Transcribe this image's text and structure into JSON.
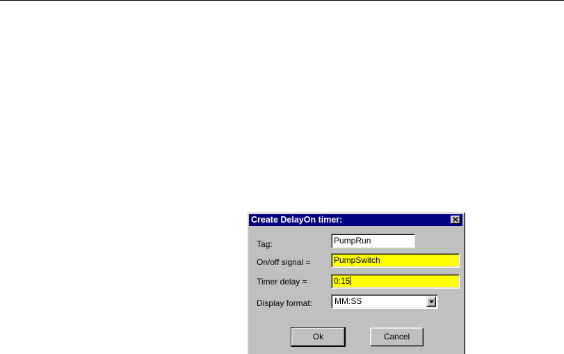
{
  "dialog": {
    "title": "Create DelayOn timer:",
    "fields": {
      "tag": {
        "label": "Tag:",
        "value": "PumpRun"
      },
      "signal": {
        "label": "On/off signal =",
        "value": "PumpSwitch"
      },
      "delay": {
        "label": "Timer delay =",
        "value": "0:15"
      },
      "format": {
        "label": "Display format:",
        "value": "MM:SS"
      }
    },
    "buttons": {
      "ok": "Ok",
      "cancel": "Cancel"
    }
  },
  "colors": {
    "titlebar": "#000080",
    "dialog_face": "#c0c0c0",
    "highlight_field": "#ffff00"
  },
  "icons": {
    "close": "close-icon",
    "dropdown": "chevron-down-icon"
  }
}
